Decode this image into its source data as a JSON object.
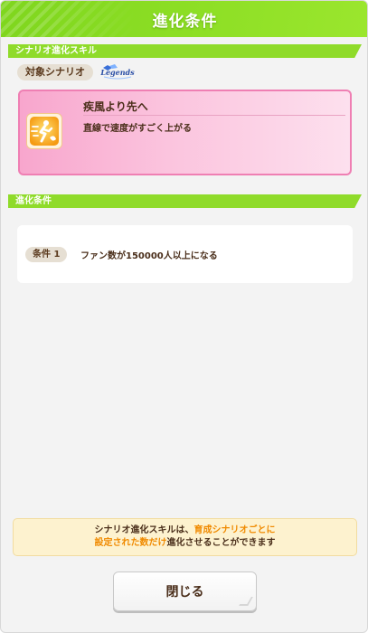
{
  "dialog": {
    "title": "進化条件"
  },
  "scenario_section": {
    "heading": "シナリオ進化スキル",
    "target_label": "対象シナリオ",
    "scenario_logo_text": "Legends"
  },
  "skill": {
    "name": "疾風より先へ",
    "description": "直線で速度がすごく上がる",
    "icon": "speed-skill-icon"
  },
  "condition_section": {
    "heading": "進化条件",
    "conditions": [
      {
        "label": "条件 1",
        "text": "ファン数が150000人以上になる"
      }
    ]
  },
  "info": {
    "line1_prefix": "シナリオ進化スキルは、",
    "line1_highlight": "育成シナリオごとに",
    "line2_highlight": "設定された数だけ",
    "line2_suffix": "進化させることができます"
  },
  "close_button": {
    "label": "閉じる"
  },
  "colors": {
    "accent_green": "#8fdb2a",
    "highlight_orange": "#f08a00",
    "skill_pink": "#f8a6cd",
    "text_brown": "#4a2e1a"
  }
}
